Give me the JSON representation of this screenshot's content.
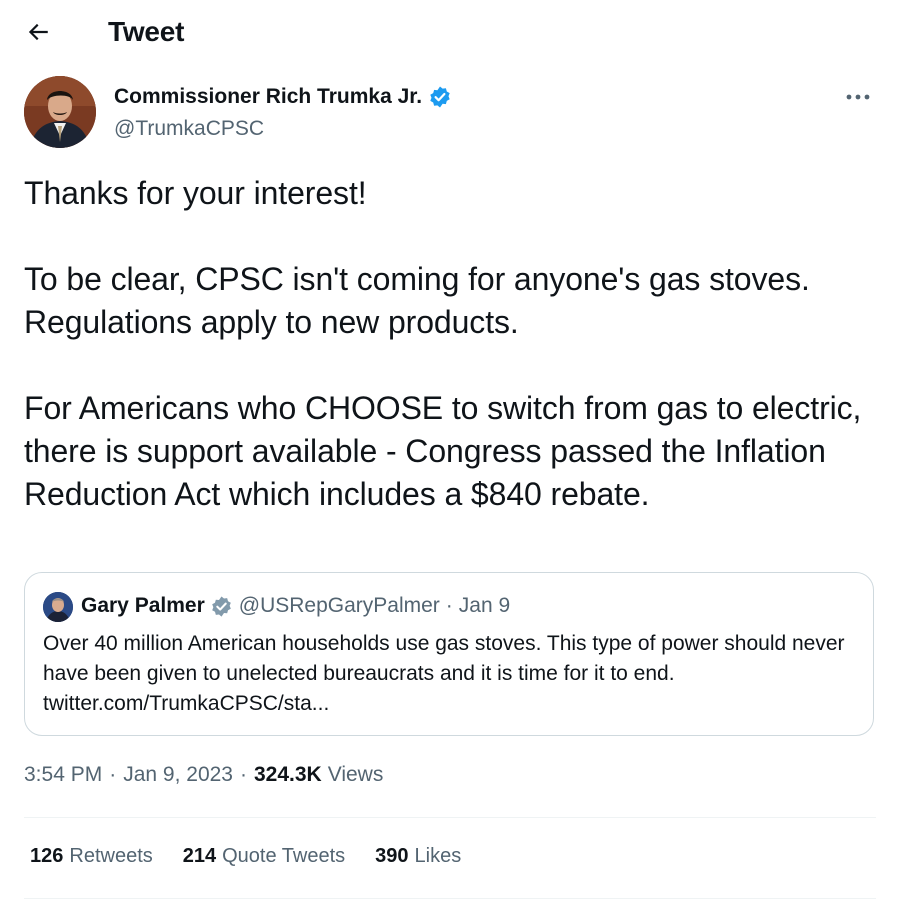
{
  "header": {
    "title": "Tweet"
  },
  "tweet": {
    "author": {
      "name": "Commissioner Rich Trumka Jr.",
      "handle": "@TrumkaCPSC"
    },
    "text": "Thanks for your interest!\n\nTo be clear, CPSC isn't coming for anyone's gas stoves. Regulations apply to new products.\n\nFor Americans who CHOOSE to switch from gas to electric, there is support available - Congress passed the Inflation Reduction Act which includes a $840 rebate.",
    "quote": {
      "name": "Gary Palmer",
      "handle": "@USRepGaryPalmer",
      "separator": "·",
      "date": "Jan 9",
      "text": "Over 40 million American households use gas stoves. This type of power should never have been given to unelected bureaucrats and it is time for it to end. twitter.com/TrumkaCPSC/sta..."
    },
    "meta": {
      "time": "3:54 PM",
      "separator": "·",
      "date": "Jan 9, 2023",
      "views_count": "324.3K",
      "views_label": "Views"
    },
    "stats": {
      "retweets": {
        "count": "126",
        "label": "Retweets"
      },
      "quote_tweets": {
        "count": "214",
        "label": "Quote Tweets"
      },
      "likes": {
        "count": "390",
        "label": "Likes"
      }
    }
  },
  "icons": {
    "back": "arrow-left-icon",
    "more": "more-horizontal-icon",
    "verified": "verified-badge-icon"
  },
  "colors": {
    "text": "#0f1419",
    "secondary": "#536471",
    "verified": "#1d9bf0",
    "border": "#cfd9de"
  }
}
